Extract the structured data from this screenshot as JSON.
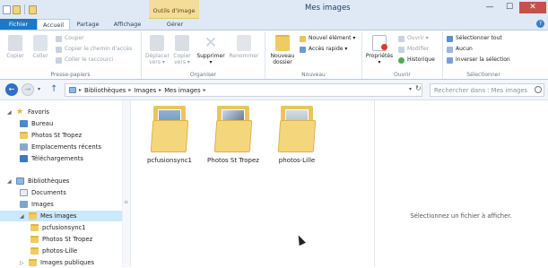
{
  "window": {
    "title": "Mes images",
    "context_tab": "Outils d'image",
    "minimize": "—",
    "maximize": "☐",
    "close": "✕"
  },
  "tabs": {
    "fichier": "Fichier",
    "accueil": "Accueil",
    "partage": "Partage",
    "affichage": "Affichage",
    "gerer": "Gérer",
    "help": "?"
  },
  "ribbon": {
    "presse_papiers": {
      "label": "Presse-papiers",
      "copier": "Copier",
      "coller": "Coller",
      "couper": "Couper",
      "copier_chemin": "Copier le chemin d'accès",
      "coller_raccourci": "Coller le raccourci"
    },
    "organiser": {
      "label": "Organiser",
      "deplacer": "Déplacer",
      "deplacer2": "vers ▾",
      "copier": "Copier",
      "copier2": "vers ▾",
      "supprimer": "Supprimer",
      "supprimer2": "▾",
      "renommer": "Renommer"
    },
    "nouveau": {
      "label": "Nouveau",
      "nouveau_dossier": "Nouveau",
      "nouveau_dossier2": "dossier",
      "nouvel_element": "Nouvel élément ▾",
      "acces_rapide": "Accès rapide ▾"
    },
    "ouvrir": {
      "label": "Ouvrir",
      "proprietes": "Propriétés",
      "proprietes2": "▾",
      "ouvrir": "Ouvrir ▾",
      "modifier": "Modifier",
      "historique": "Historique"
    },
    "selectionner": {
      "label": "Sélectionner",
      "tout": "Sélectionner tout",
      "aucun": "Aucun",
      "inverser": "Inverser la sélection"
    }
  },
  "address": {
    "crumbs": [
      "Bibliothèques",
      "Images",
      "Mes images"
    ],
    "search_placeholder": "Rechercher dans : Mes images"
  },
  "nav": {
    "favoris": "Favoris",
    "bureau": "Bureau",
    "photos": "Photos St Tropez",
    "recents": "Emplacements récents",
    "telechargements": "Téléchargements",
    "bibliotheques": "Bibliothèques",
    "documents": "Documents",
    "images": "Images",
    "mes_images": "Mes images",
    "sub1": "pcfusionsync1",
    "sub2": "Photos St Tropez",
    "sub3": "photos-Lille",
    "publiques": "Images publiques"
  },
  "files": [
    {
      "name": "pcfusionsync1",
      "photo_color": "#6a86a8"
    },
    {
      "name": "Photos St Tropez",
      "photo_color": "#7a8fae"
    },
    {
      "name": "photos-Lille",
      "photo_color": "#8f9aa5"
    }
  ],
  "detail": {
    "empty_text": "Sélectionnez un fichier à afficher."
  }
}
